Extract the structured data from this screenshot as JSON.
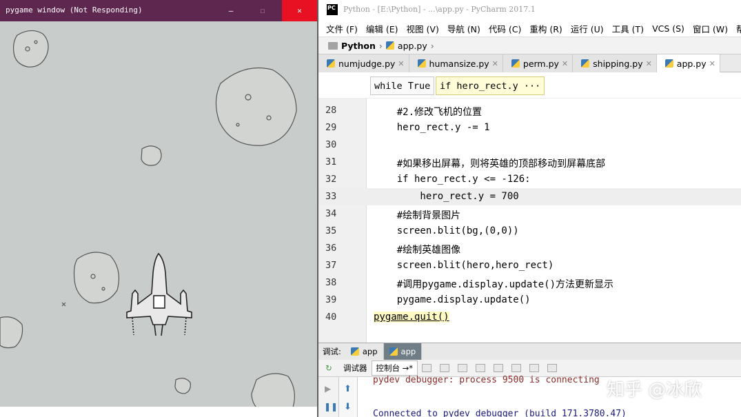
{
  "pygame_window": {
    "title": "pygame window (Not Responding)",
    "minimize_glyph": "—",
    "maximize_glyph": "☐",
    "close_glyph": "✕"
  },
  "ide": {
    "title": "Python - [E:\\Python] - ...\\app.py - PyCharm 2017.1",
    "logo": "PC",
    "menu": [
      "文件 (F)",
      "编辑 (E)",
      "视图 (V)",
      "导航 (N)",
      "代码 (C)",
      "重构 (R)",
      "运行 (U)",
      "工具 (T)",
      "VCS (S)",
      "窗口 (W)",
      "帮助"
    ],
    "breadcrumb": {
      "project": "Python",
      "file": "app.py"
    },
    "tabs": [
      {
        "label": "numjudge.py",
        "active": false
      },
      {
        "label": "humansize.py",
        "active": false
      },
      {
        "label": "perm.py",
        "active": false
      },
      {
        "label": "shipping.py",
        "active": false
      },
      {
        "label": "app.py",
        "active": true
      }
    ],
    "code_crumbs": [
      "while True",
      "if hero_rect.y ···"
    ],
    "lines": [
      {
        "num": "28",
        "code": "    #2.修改飞机的位置"
      },
      {
        "num": "29",
        "code": "    hero_rect.y -= 1"
      },
      {
        "num": "30",
        "code": ""
      },
      {
        "num": "31",
        "code": "    #如果移出屏幕，则将英雄的顶部移动到屏幕底部"
      },
      {
        "num": "32",
        "code": "    if hero_rect.y <= -126:"
      },
      {
        "num": "33",
        "code": "        hero_rect.y = 700"
      },
      {
        "num": "34",
        "code": "    #绘制背景图片"
      },
      {
        "num": "35",
        "code": "    screen.blit(bg,(0,0))"
      },
      {
        "num": "36",
        "code": "    #绘制英雄图像"
      },
      {
        "num": "37",
        "code": "    screen.blit(hero,hero_rect)"
      },
      {
        "num": "38",
        "code": "    #调用pygame.display.update()方法更新显示"
      },
      {
        "num": "39",
        "code": "    pygame.display.update()"
      },
      {
        "num": "40",
        "code": "pygame.quit()"
      }
    ],
    "debug": {
      "label": "调试:",
      "tabs": [
        "app",
        "app"
      ],
      "tool_tabs": [
        "调试器",
        "控制台 →*"
      ],
      "console_line1": "pydev debugger: process 9500 is connecting",
      "console_line2": "Connected to pydev debugger (build 171.3780.47)"
    },
    "watermark": "知乎 @冰欣",
    "colors": {
      "title_bar": "#5e2750",
      "close_red": "#e81123",
      "active_debug_tab": "#6f7d86"
    }
  }
}
